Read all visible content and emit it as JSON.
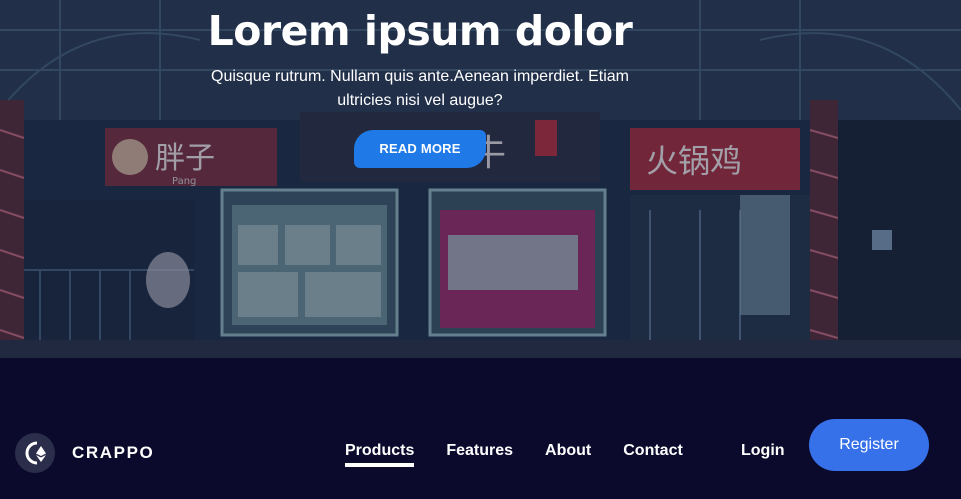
{
  "hero": {
    "title": "Lorem ipsum dolor",
    "subtitle": "Quisque rutrum. Nullam quis ante.Aenean imperdiet. Etiam ultricies nisi vel augue?",
    "cta_label": "READ MORE",
    "background_image": "night-street-storefronts",
    "sign_left": "胖子",
    "sign_left_caption": "Pang",
    "sign_right": "火锅鸡",
    "sign_center": "牛",
    "colors": {
      "cta": "#1f7ae8",
      "overlay": "#0e1634"
    }
  },
  "navbar": {
    "brand": "CRAPPO",
    "logo_icon": "crypto-coin-logo-icon",
    "links": [
      {
        "label": "Products",
        "active": true
      },
      {
        "label": "Features",
        "active": false
      },
      {
        "label": "About",
        "active": false
      },
      {
        "label": "Contact",
        "active": false
      }
    ],
    "login_label": "Login",
    "register_label": "Register",
    "colors": {
      "background": "#0b0a2c",
      "register": "#3671e9"
    }
  }
}
